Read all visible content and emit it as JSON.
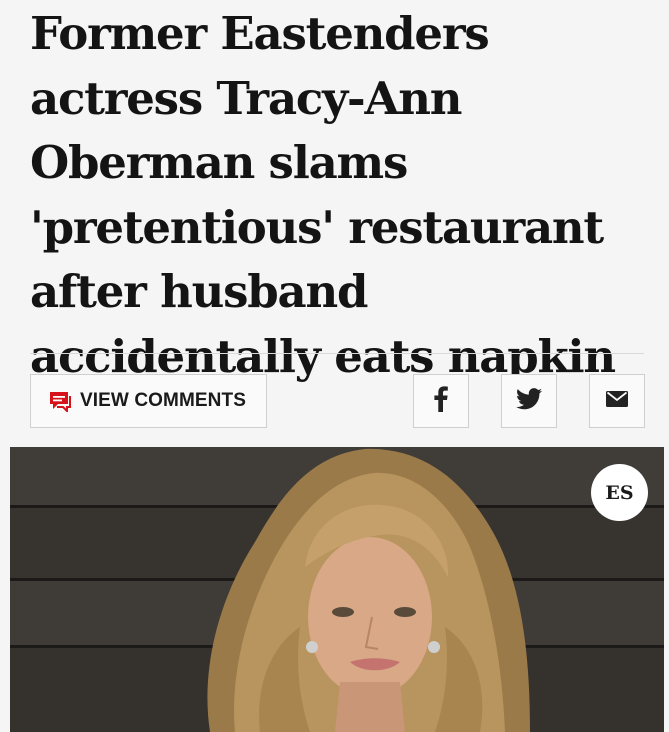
{
  "article": {
    "headline": "Former Eastenders actress Tracy-Ann Oberman slams 'pretentious' restaurant after husband accidentally eats napkin"
  },
  "actions": {
    "comments_label": "VIEW COMMENTS",
    "accent_color": "#d6131b"
  },
  "share": {
    "facebook_icon": "facebook-icon",
    "twitter_icon": "twitter-icon",
    "email_icon": "envelope-icon"
  },
  "hero": {
    "logo_text": "ES"
  }
}
